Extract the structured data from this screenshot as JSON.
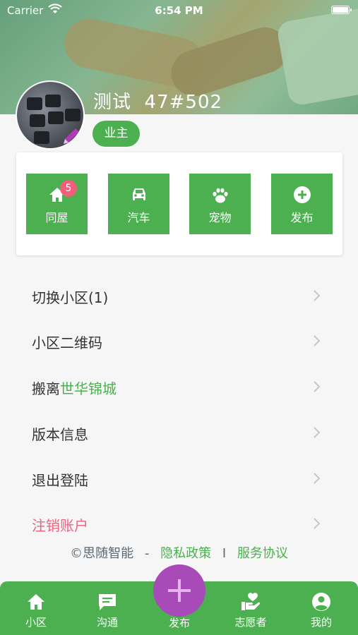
{
  "status_bar": {
    "carrier": "Carrier",
    "time": "6:54 PM"
  },
  "profile": {
    "name": "测试",
    "unit": "47#502",
    "role": "业主"
  },
  "quick_actions": [
    {
      "label": "同屋",
      "icon": "home-icon",
      "badge": "5"
    },
    {
      "label": "汽车",
      "icon": "car-icon"
    },
    {
      "label": "宠物",
      "icon": "paw-icon"
    },
    {
      "label": "发布",
      "icon": "plus-circle-icon"
    }
  ],
  "menu": {
    "switch_community": "切换小区(1)",
    "qr_code": "小区二维码",
    "move_out_prefix": "搬离",
    "move_out_community": "世华锦城",
    "version_info": "版本信息",
    "logout": "退出登陆",
    "delete_account": "注销账户"
  },
  "footer": {
    "company": "©思随智能",
    "dash": "-",
    "privacy": "隐私政策",
    "divider": "I",
    "agreement": "服务协议"
  },
  "tabbar": {
    "community": "小区",
    "chat": "沟通",
    "publish": "发布",
    "volunteer": "志愿者",
    "mine": "我的"
  },
  "colors": {
    "primary": "#4caf50",
    "fab": "#a94ab9",
    "danger": "#f06283",
    "badge": "#f25f7a"
  }
}
